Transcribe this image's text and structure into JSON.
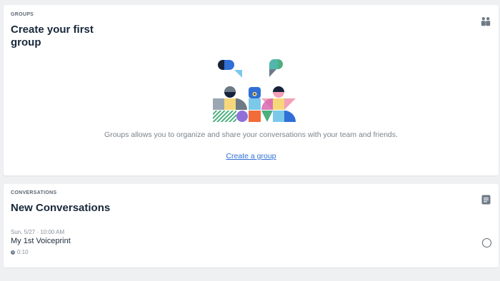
{
  "groups": {
    "eyebrow": "GROUPS",
    "title": "Create your first group",
    "description": "Groups allows you to organize and share your conversations with your team and friends.",
    "create_link": "Create a group",
    "icon": "groups-icon"
  },
  "conversations": {
    "eyebrow": "CONVERSATIONS",
    "title": "New Conversations",
    "icon": "document-icon",
    "items": [
      {
        "date": "Sun, 5/27 · 10:00 AM",
        "name": "My 1st Voiceprint",
        "duration": "0:10",
        "selected": false
      }
    ]
  },
  "colors": {
    "link": "#2f6fd6",
    "title": "#18283a",
    "background": "#eef0f2"
  }
}
